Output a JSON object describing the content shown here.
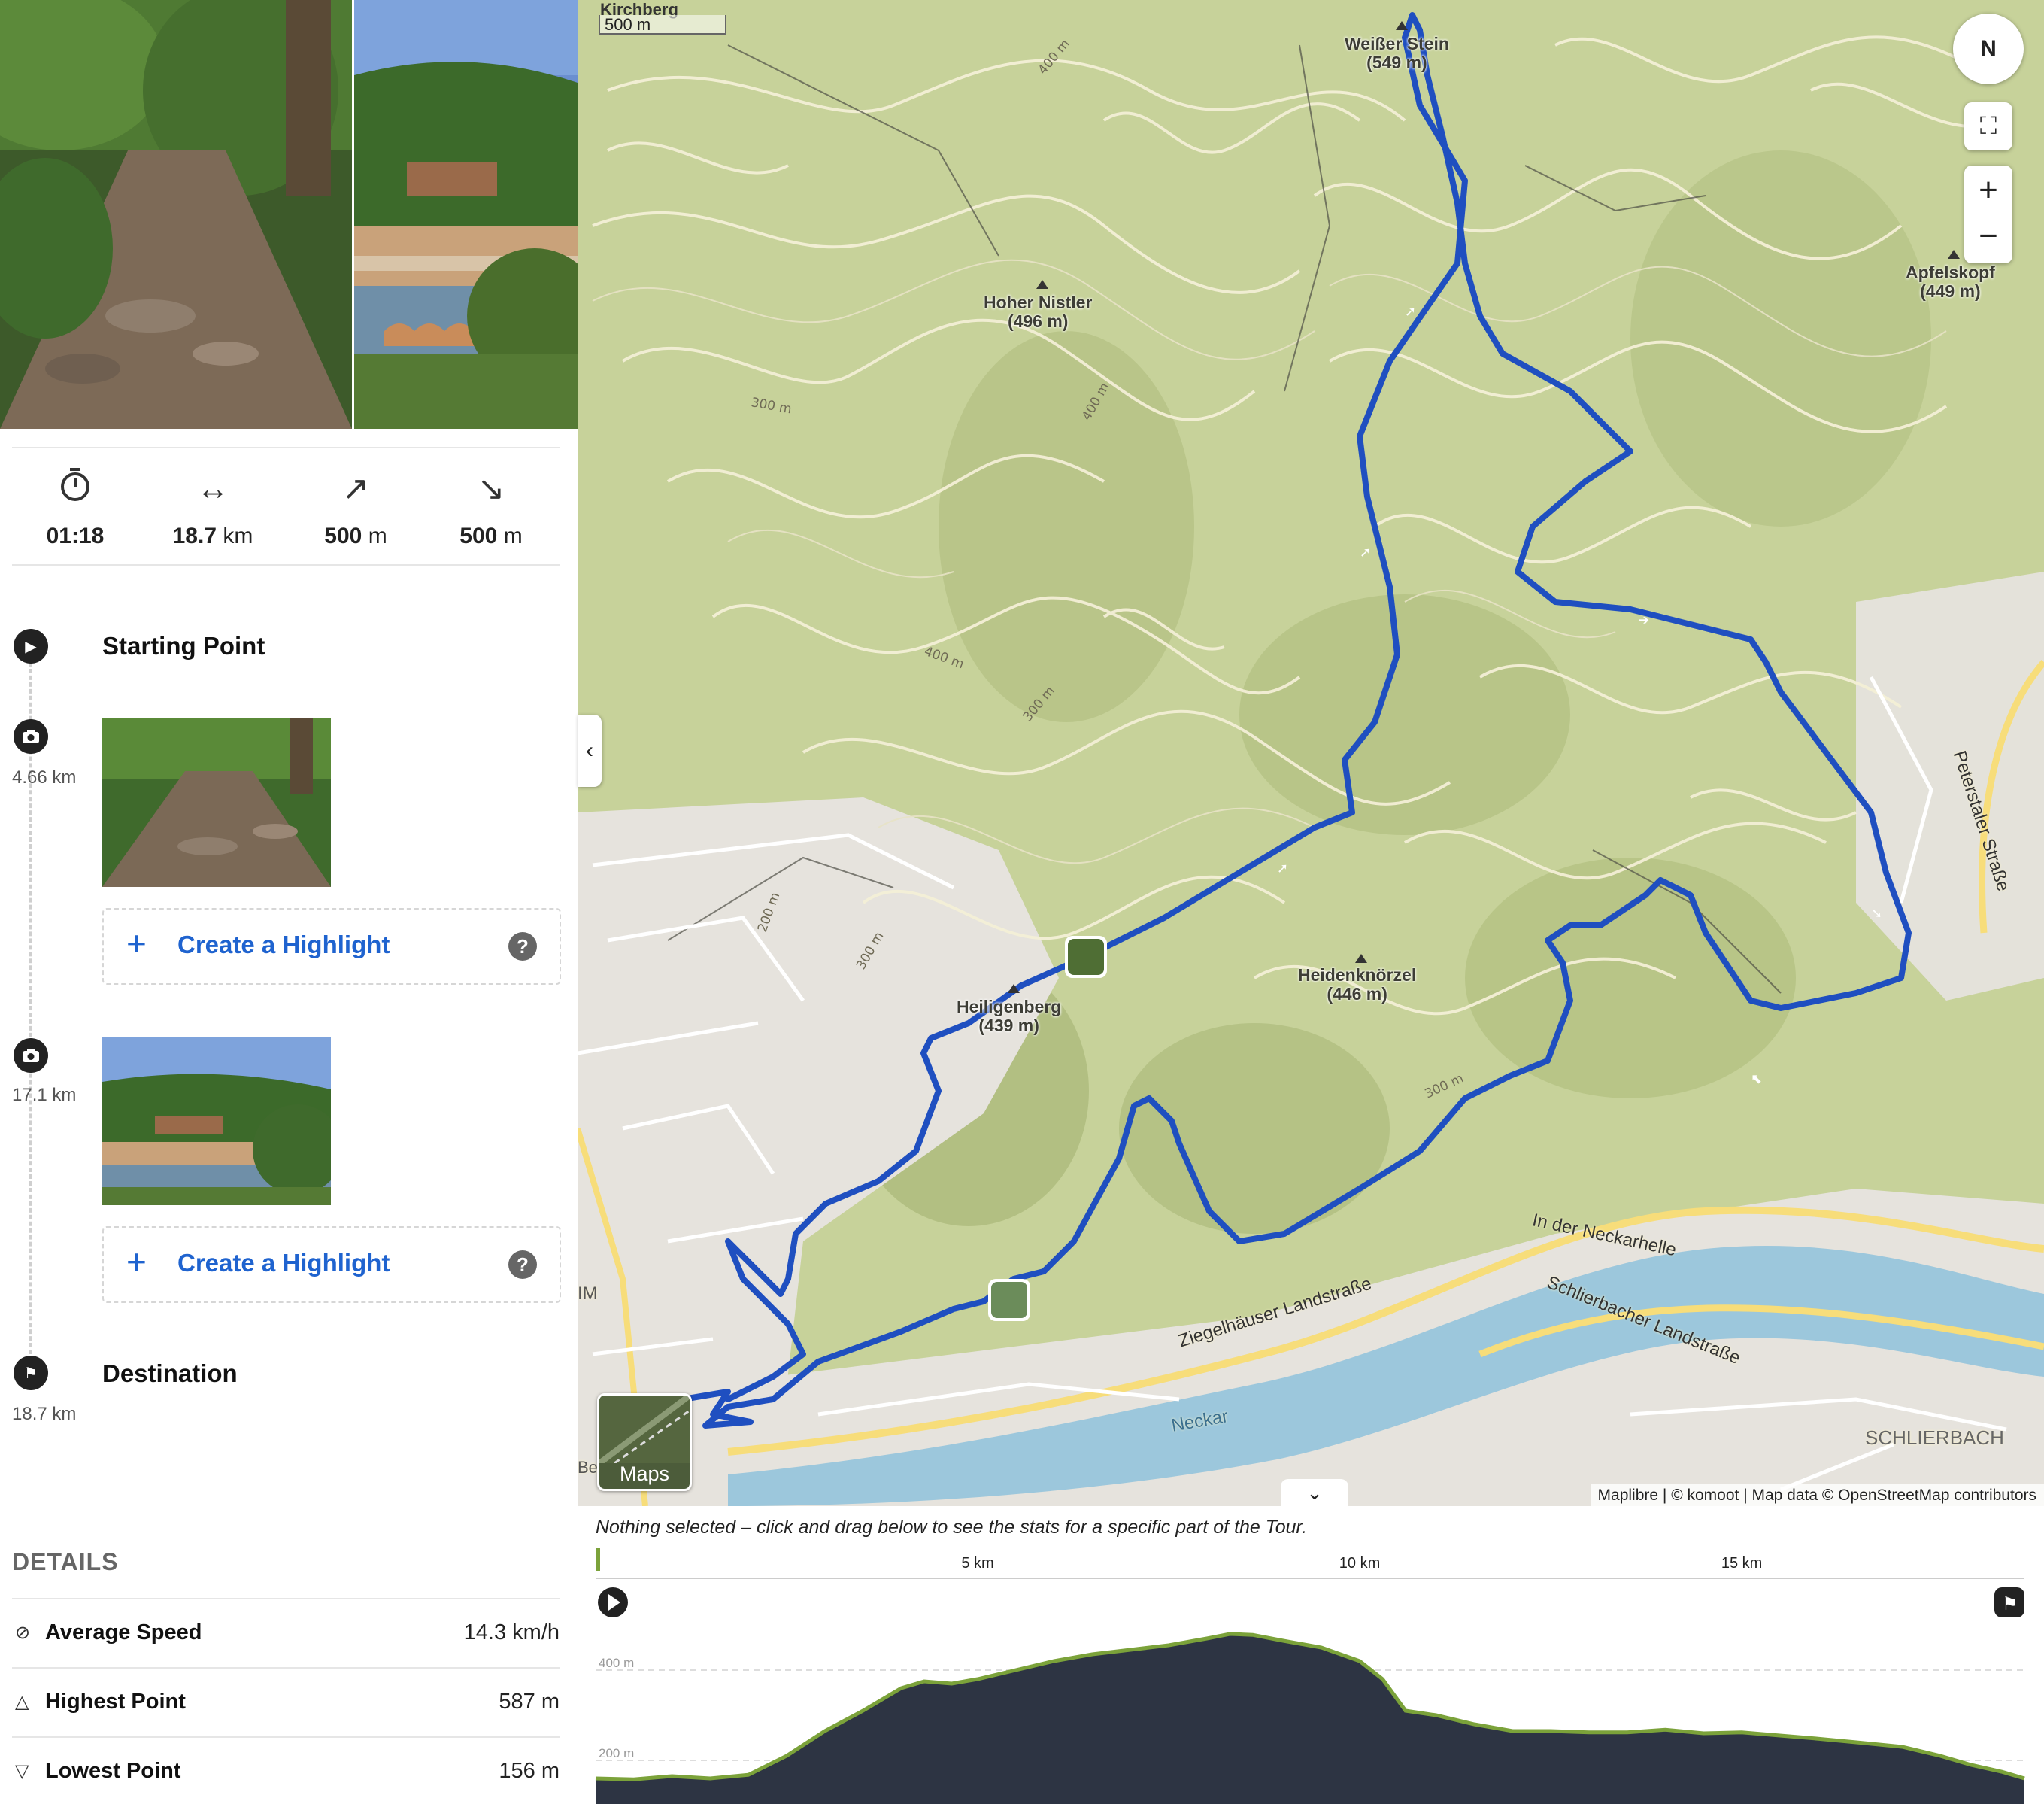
{
  "summary": {
    "duration": "01:18",
    "distance_value": "18.7",
    "distance_unit": "km",
    "uphill_value": "500",
    "uphill_unit": "m",
    "downhill_value": "500",
    "downhill_unit": "m"
  },
  "timeline": {
    "start_label": "Starting Point",
    "photo1_km": "4.66 km",
    "photo2_km": "17.1 km",
    "highlight_label": "Create a Highlight",
    "highlight_help": "?",
    "destination_label": "Destination",
    "destination_km": "18.7 km"
  },
  "details": {
    "heading": "DETAILS",
    "rows": [
      {
        "label": "Average Speed",
        "value": "14.3 km/h",
        "icon": "speed-icon"
      },
      {
        "label": "Highest Point",
        "value": "587 m",
        "icon": "triangle-up-icon"
      },
      {
        "label": "Lowest Point",
        "value": "156 m",
        "icon": "triangle-down-icon"
      }
    ]
  },
  "map": {
    "scale_place": "Kirchberg",
    "scale_label": "500 m",
    "compass": "N",
    "zoom_in": "+",
    "zoom_out": "−",
    "layer_button": "Maps",
    "attribution": "Maplibre | © komoot | Map data © OpenStreetMap contributors",
    "peaks": [
      {
        "name": "Weißer Stein",
        "elev": "(549 m)"
      },
      {
        "name": "Hoher Nistler",
        "elev": "(496 m)"
      },
      {
        "name": "Apfelskopf",
        "elev": "(449 m)"
      },
      {
        "name": "Heiligenberg",
        "elev": "(439 m)"
      },
      {
        "name": "Heidenknörzel",
        "elev": "(446 m)"
      }
    ],
    "roads": {
      "ziegel": "Ziegelhäuser Landstraße",
      "neckarhelle": "In der Neckarhelle",
      "schlierbacher": "Schlierbacher Landstraße",
      "petersthaler": "Peterstaler Straße",
      "neckar": "Neckar",
      "schlierbach": "SCHLIERBACH",
      "im": "IM",
      "be": "Be"
    },
    "contours": {
      "c300": "300 m",
      "c400": "400 m",
      "c200": "200 m"
    },
    "colors": {
      "route": "#1f4fc0",
      "forest": "#c9d39a",
      "water": "#9cc7dc",
      "road_major": "#f7dd7a"
    }
  },
  "elevation": {
    "message": "Nothing selected – click and drag below to see the stats for a specific part of the Tour.",
    "km_labels": [
      "5 km",
      "10 km",
      "15 km"
    ],
    "y_labels": [
      "400 m",
      "200 m"
    ],
    "profile": [
      [
        0,
        160
      ],
      [
        0.5,
        158
      ],
      [
        1,
        165
      ],
      [
        1.5,
        160
      ],
      [
        2,
        168
      ],
      [
        2.5,
        210
      ],
      [
        3,
        265
      ],
      [
        3.5,
        310
      ],
      [
        4,
        360
      ],
      [
        4.3,
        375
      ],
      [
        4.66,
        370
      ],
      [
        5,
        380
      ],
      [
        5.5,
        400
      ],
      [
        6,
        420
      ],
      [
        6.5,
        435
      ],
      [
        7,
        445
      ],
      [
        7.5,
        455
      ],
      [
        8,
        470
      ],
      [
        8.3,
        480
      ],
      [
        8.6,
        478
      ],
      [
        9,
        465
      ],
      [
        9.5,
        450
      ],
      [
        10,
        420
      ],
      [
        10.3,
        380
      ],
      [
        10.6,
        310
      ],
      [
        11,
        300
      ],
      [
        11.5,
        280
      ],
      [
        12,
        265
      ],
      [
        12.5,
        265
      ],
      [
        13,
        262
      ],
      [
        13.5,
        262
      ],
      [
        14,
        268
      ],
      [
        14.5,
        260
      ],
      [
        15,
        262
      ],
      [
        15.5,
        255
      ],
      [
        16,
        248
      ],
      [
        16.5,
        240
      ],
      [
        17.1,
        230
      ],
      [
        17.6,
        210
      ],
      [
        18,
        190
      ],
      [
        18.4,
        175
      ],
      [
        18.7,
        160
      ]
    ],
    "max_km": 18.7
  }
}
